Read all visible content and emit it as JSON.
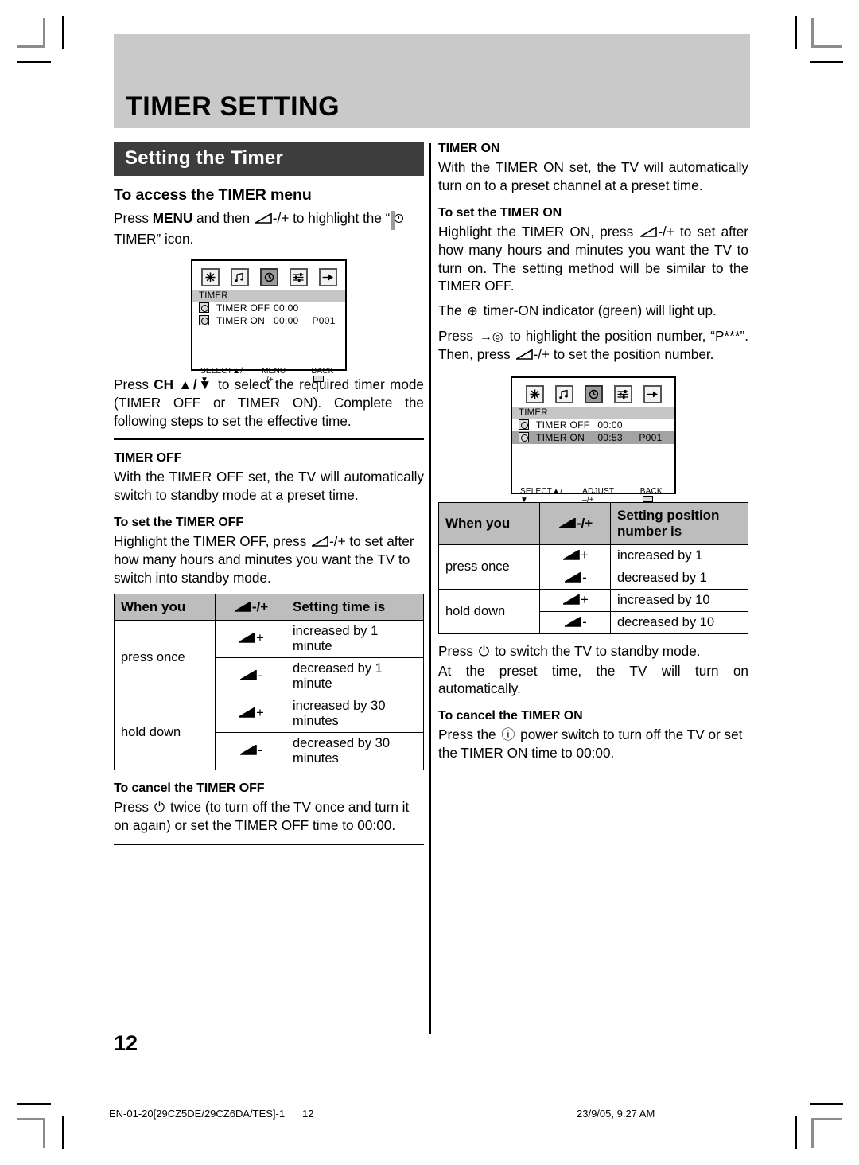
{
  "page": {
    "title": "TIMER SETTING",
    "number": "12"
  },
  "footer": {
    "file": "EN-01-20[29CZ5DE/29CZ6DA/TES]-1",
    "page": "12",
    "date": "23/9/05, 9:27 AM"
  },
  "left": {
    "section_title": "Setting the Timer",
    "access_head": "To access the TIMER menu",
    "access_text_1": "Press ",
    "access_text_menu": "MENU",
    "access_text_2": " and then ",
    "access_text_3": "-/+ to highlight the “",
    "access_text_4": " TIMER” icon.",
    "after_menu_text_1": "Press ",
    "after_menu_ch": "CH",
    "after_menu_arrows": " ▲/▼",
    "after_menu_text_2": " to select the required timer mode (TIMER OFF or TIMER ON). Complete the following steps to set the effective time.",
    "timer_off_head": "TIMER OFF",
    "timer_off_text": "With the TIMER OFF set, the TV will automatically switch to standby mode at a preset time.",
    "set_off_head": "To set the TIMER OFF",
    "set_off_text_1": "Highlight the TIMER OFF, press ",
    "set_off_text_2": "-/+ to set after how many hours and minutes you want the TV to switch into standby mode.",
    "cancel_off_head": "To cancel the TIMER OFF",
    "cancel_off_text_1": "Press ",
    "cancel_off_text_2": " twice (to turn off the TV once and turn it on again) or set the TIMER OFF time to 00:00."
  },
  "right": {
    "timer_on_head": "TIMER ON",
    "timer_on_text": "With the TIMER ON set, the TV will automatically turn on to a preset channel at a preset time.",
    "set_on_head": "To set the TIMER ON",
    "set_on_text_1": "Highlight the TIMER ON, press ",
    "set_on_text_2": "-/+ to set after how many hours and minutes you want the TV to turn on. The setting method will be similar to the TIMER OFF.",
    "indicator_text_1": "The ",
    "indicator_text_2": " timer-ON indicator (green) will light up.",
    "position_text_1": "Press ",
    "position_text_2": " to highlight the position number, “P***”. Then, press ",
    "position_text_3": "-/+ to set the position number.",
    "standby_text_1": "Press ",
    "standby_text_2": " to switch the TV to standby mode.",
    "standby_text_3": "At the preset time, the TV will turn on automatically.",
    "cancel_on_head": "To cancel the TIMER ON",
    "cancel_on_text_1": "Press the ",
    "cancel_on_text_2": " power switch to turn off the TV or set the TIMER ON time to 00:00."
  },
  "osd_menu_1": {
    "icons": [
      {
        "name": "picture-icon",
        "glyph": "✱",
        "selected": false
      },
      {
        "name": "sound-icon",
        "glyph": "♫",
        "selected": false
      },
      {
        "name": "timer-icon",
        "glyph": "◴",
        "selected": true
      },
      {
        "name": "features-icon",
        "glyph": "≡",
        "selected": false
      },
      {
        "name": "install-icon",
        "glyph": "⬌",
        "selected": false
      }
    ],
    "title": "TIMER",
    "rows": [
      {
        "label": "TIMER OFF",
        "time": "00:00",
        "position": "",
        "highlighted": false
      },
      {
        "label": "TIMER ON",
        "time": "00:00",
        "position": "P001",
        "highlighted": false
      }
    ],
    "footer": [
      "SELECT▲/▼",
      "MENU –/+",
      "BACK"
    ]
  },
  "osd_menu_2": {
    "icons": [
      {
        "name": "picture-icon",
        "glyph": "✱",
        "selected": false
      },
      {
        "name": "sound-icon",
        "glyph": "♫",
        "selected": false
      },
      {
        "name": "timer-icon",
        "glyph": "◴",
        "selected": true
      },
      {
        "name": "features-icon",
        "glyph": "≡",
        "selected": false
      },
      {
        "name": "install-icon",
        "glyph": "⬌",
        "selected": false
      }
    ],
    "title": "TIMER",
    "rows": [
      {
        "label": "TIMER OFF",
        "time": "00:00",
        "position": "",
        "highlighted": false
      },
      {
        "label": "TIMER ON",
        "time": "00:53",
        "position": "P001",
        "highlighted": true
      }
    ],
    "footer": [
      "SELECT▲/▼",
      "ADJUST –/+",
      "BACK"
    ]
  },
  "table_time": {
    "headers": [
      "When you",
      "-/+",
      "Setting time is"
    ],
    "rows": [
      {
        "when": "press once",
        "key": "+",
        "result": "increased by 1 minute"
      },
      {
        "when": "",
        "key": "-",
        "result": "decreased by 1 minute"
      },
      {
        "when": "hold down",
        "key": "+",
        "result": "increased by 30 minutes"
      },
      {
        "when": "",
        "key": "-",
        "result": "decreased by 30 minutes"
      }
    ]
  },
  "table_position": {
    "headers": [
      "When you",
      "-/+",
      "Setting position number is"
    ],
    "header_line_1": "Setting position",
    "header_line_2": "number is",
    "rows": [
      {
        "when": "press once",
        "key": "+",
        "result": "increased by 1"
      },
      {
        "when": "",
        "key": "-",
        "result": "decreased by 1"
      },
      {
        "when": "hold down",
        "key": "+",
        "result": "increased by 10"
      },
      {
        "when": "",
        "key": "-",
        "result": "decreased by 10"
      }
    ]
  },
  "colors": {
    "banner_bg": "#c9c9c9",
    "section_bar_bg": "#3d3d3d",
    "table_header_bg": "#bdbdbd",
    "osd_highlight": "#a3a3a3"
  }
}
